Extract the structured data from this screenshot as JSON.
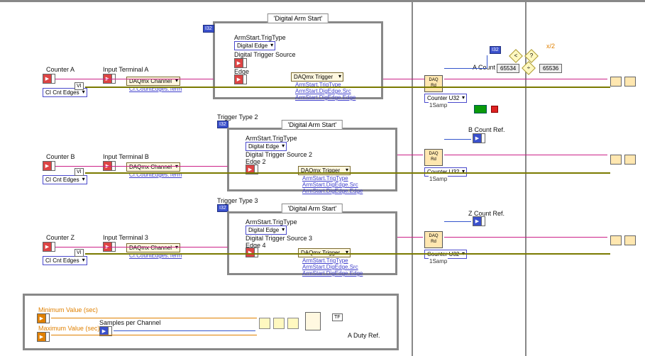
{
  "frames": {
    "f1": {
      "title": "'Digital Arm Start'"
    },
    "f2": {
      "title": "'Digital Arm Start'"
    },
    "f3": {
      "title": "'Digital Arm Start'"
    }
  },
  "channelA": {
    "counter_label": "Counter A",
    "terminal_label": "Input Terminal A",
    "selector": "CI Cnt Edges",
    "chan_prop": "DAQmx Channel",
    "chan_sub": "CI.CountEdges.Term",
    "trig_type_lbl": "ArmStart.TrigType",
    "digital_edge": "Digital Edge",
    "trig_src_lbl": "Digital Trigger Source",
    "edge_lbl": "Edge",
    "trignode": "DAQmx Trigger",
    "t1": "ArmStart.TrigType",
    "t2": "ArmStart.DigEdge.Src",
    "t3": "ArmStart.DigEdge.Edge",
    "read_lbl": "Counter U32",
    "read_lbl2": "1Samp",
    "acount": "A Count R",
    "aval1": "65534",
    "aval2": "65536"
  },
  "channelB": {
    "counter_label": "Counter B",
    "terminal_label": "Input Terminal B",
    "selector": "CI Cnt Edges",
    "chan_prop": "DAQmx Channel",
    "chan_sub": "CI.CountEdges.Term",
    "trig_type_title": "Trigger Type 2",
    "trig_type_lbl": "ArmStart.TrigType",
    "digital_edge": "Digital Edge",
    "trig_src_lbl": "Digital Trigger Source 2",
    "edge_lbl": "Edge 2",
    "trignode": "DAQmx Trigger",
    "t1": "ArmStart.TrigType",
    "t2": "ArmStart.DigEdge.Src",
    "t3": "ArmStart.DigEdge.Edge",
    "read_lbl": "Counter U32",
    "read_lbl2": "1Samp",
    "bcount": "B Count Ref."
  },
  "channelZ": {
    "counter_label": "Counter Z",
    "terminal_label": "Input Terminal 3",
    "selector": "CI Cnt Edges",
    "chan_prop": "DAQmx Channel",
    "chan_sub": "CI.CountEdges.Term",
    "trig_type_title": "Trigger Type 3",
    "trig_type_lbl": "ArmStart.TrigType",
    "digital_edge": "Digital Edge",
    "trig_src_lbl": "Digital Trigger Source 3",
    "edge_lbl": "Edge 4",
    "trignode": "DAQmx Trigger",
    "t1": "ArmStart.TrigType",
    "t2": "ArmStart.DigEdge.Src",
    "t3": "ArmStart.DigEdge.Edge",
    "read_lbl": "Counter U32",
    "read_lbl2": "1Samp",
    "zcount": "Z Count Ref."
  },
  "bottom": {
    "minval": "Minimum Value (sec)",
    "maxval": "Maximum Value (sec)",
    "samples": "Samples per Channel",
    "duty": "A Duty Ref.",
    "tf": "TF"
  },
  "misc": {
    "x2": "x/2",
    "bitconst": "I32"
  }
}
